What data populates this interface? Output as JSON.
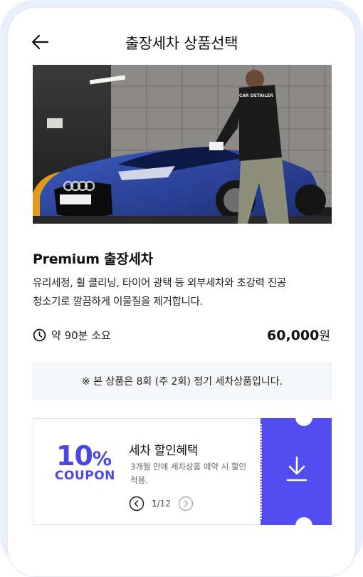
{
  "header": {
    "title": "출장세차 상품선택",
    "back_icon": "arrow-left-icon"
  },
  "hero": {
    "logo_text": "CAR DETAILER"
  },
  "product": {
    "name": "Premium 출장세차",
    "description_line1": "유리세정, 휠 클리닝, 타이어 광택 등 외부세차와 초강력 진공",
    "description_line2": "청소기로 깔끔하게 이물질을 제거합니다.",
    "duration_icon": "clock-icon",
    "duration": "약 90분 소요",
    "price": "60,000",
    "price_unit": "원"
  },
  "notice": {
    "text": "※ 본 상품은 8회 (주 2회) 정기 세차상품입니다."
  },
  "coupon": {
    "percent": "10",
    "percent_sign": "%",
    "word": "COUPON",
    "title": "세차 할인혜택",
    "description": "3개월 안에 세차상품 예약 시 할인적용.",
    "page_current": "1",
    "page_total": "/12",
    "download_icon": "download-icon",
    "accent_color": "#514df0"
  }
}
